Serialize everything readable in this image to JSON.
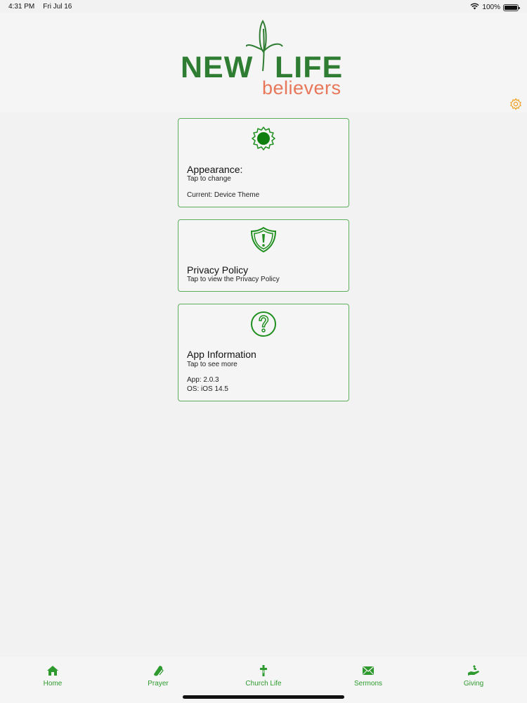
{
  "status_bar": {
    "time": "4:31 PM",
    "date": "Fri Jul 16",
    "battery_text": "100%",
    "battery_level": 1.0,
    "wifi_icon": "wifi-icon",
    "battery_icon": "battery-icon"
  },
  "logo": {
    "new": "NEW",
    "life": "LIFE",
    "believers": "believers"
  },
  "settings": {
    "icon": "gear-icon",
    "color": "#f0a020"
  },
  "cards": {
    "appearance": {
      "icon": "sun-gear-icon",
      "title": "Appearance:",
      "subtitle": "Tap to change",
      "current": "Current: Device Theme"
    },
    "privacy": {
      "icon": "shield-alert-icon",
      "title": "Privacy Policy",
      "subtitle": "Tap to view the Privacy Policy"
    },
    "app_info": {
      "icon": "question-circle-icon",
      "title": "App Information",
      "subtitle": "Tap to see more",
      "app_version": "App: 2.0.3",
      "os_version": "OS: iOS 14.5"
    }
  },
  "tabs": [
    {
      "label": "Home",
      "icon": "home-icon"
    },
    {
      "label": "Prayer",
      "icon": "praying-hands-icon"
    },
    {
      "label": "Church Life",
      "icon": "cross-icon"
    },
    {
      "label": "Sermons",
      "icon": "envelope-icon"
    },
    {
      "label": "Giving",
      "icon": "giving-hand-icon"
    }
  ],
  "colors": {
    "brand_green": "#2f7d32",
    "accent_orange": "#e8775a",
    "card_border": "#5cae5c",
    "tab_green": "#2e9a2e"
  }
}
